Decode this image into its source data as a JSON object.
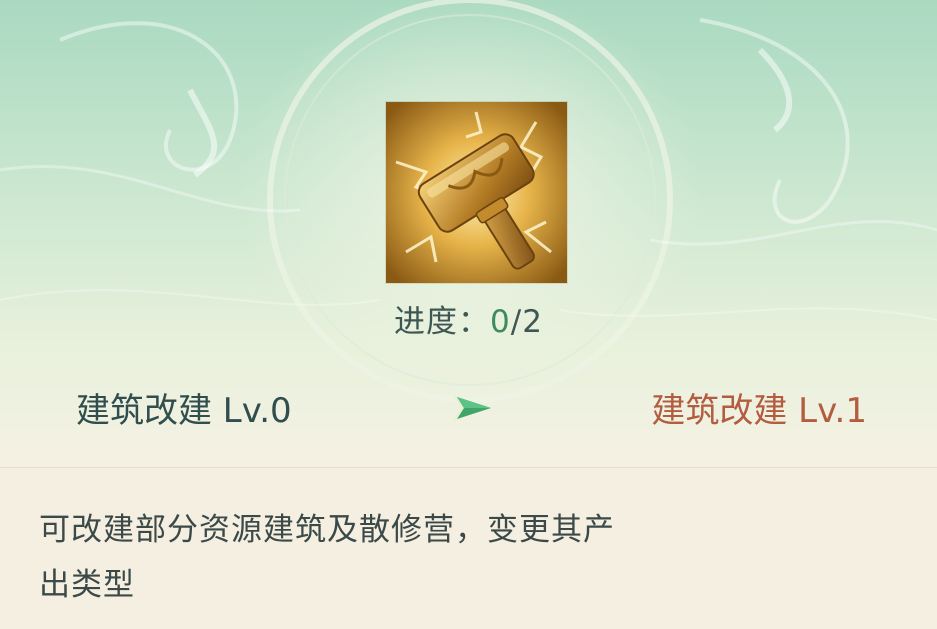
{
  "skill": {
    "icon": "golden-hammer-icon",
    "progress_label": "进度：",
    "progress_current": "0",
    "progress_separator": "/",
    "progress_max": "2"
  },
  "upgrade": {
    "current_level": "建筑改建 Lv.0",
    "arrow_icon": "arrow-right-icon",
    "next_level": "建筑改建 Lv.1"
  },
  "description": "可改建部分资源建筑及散修营，变更其产出类型",
  "colors": {
    "current_level_text": "#2f4e4d",
    "next_level_text": "#b25d3f",
    "progress_value": "#3d8a5e",
    "arrow": "#3fa56a"
  }
}
